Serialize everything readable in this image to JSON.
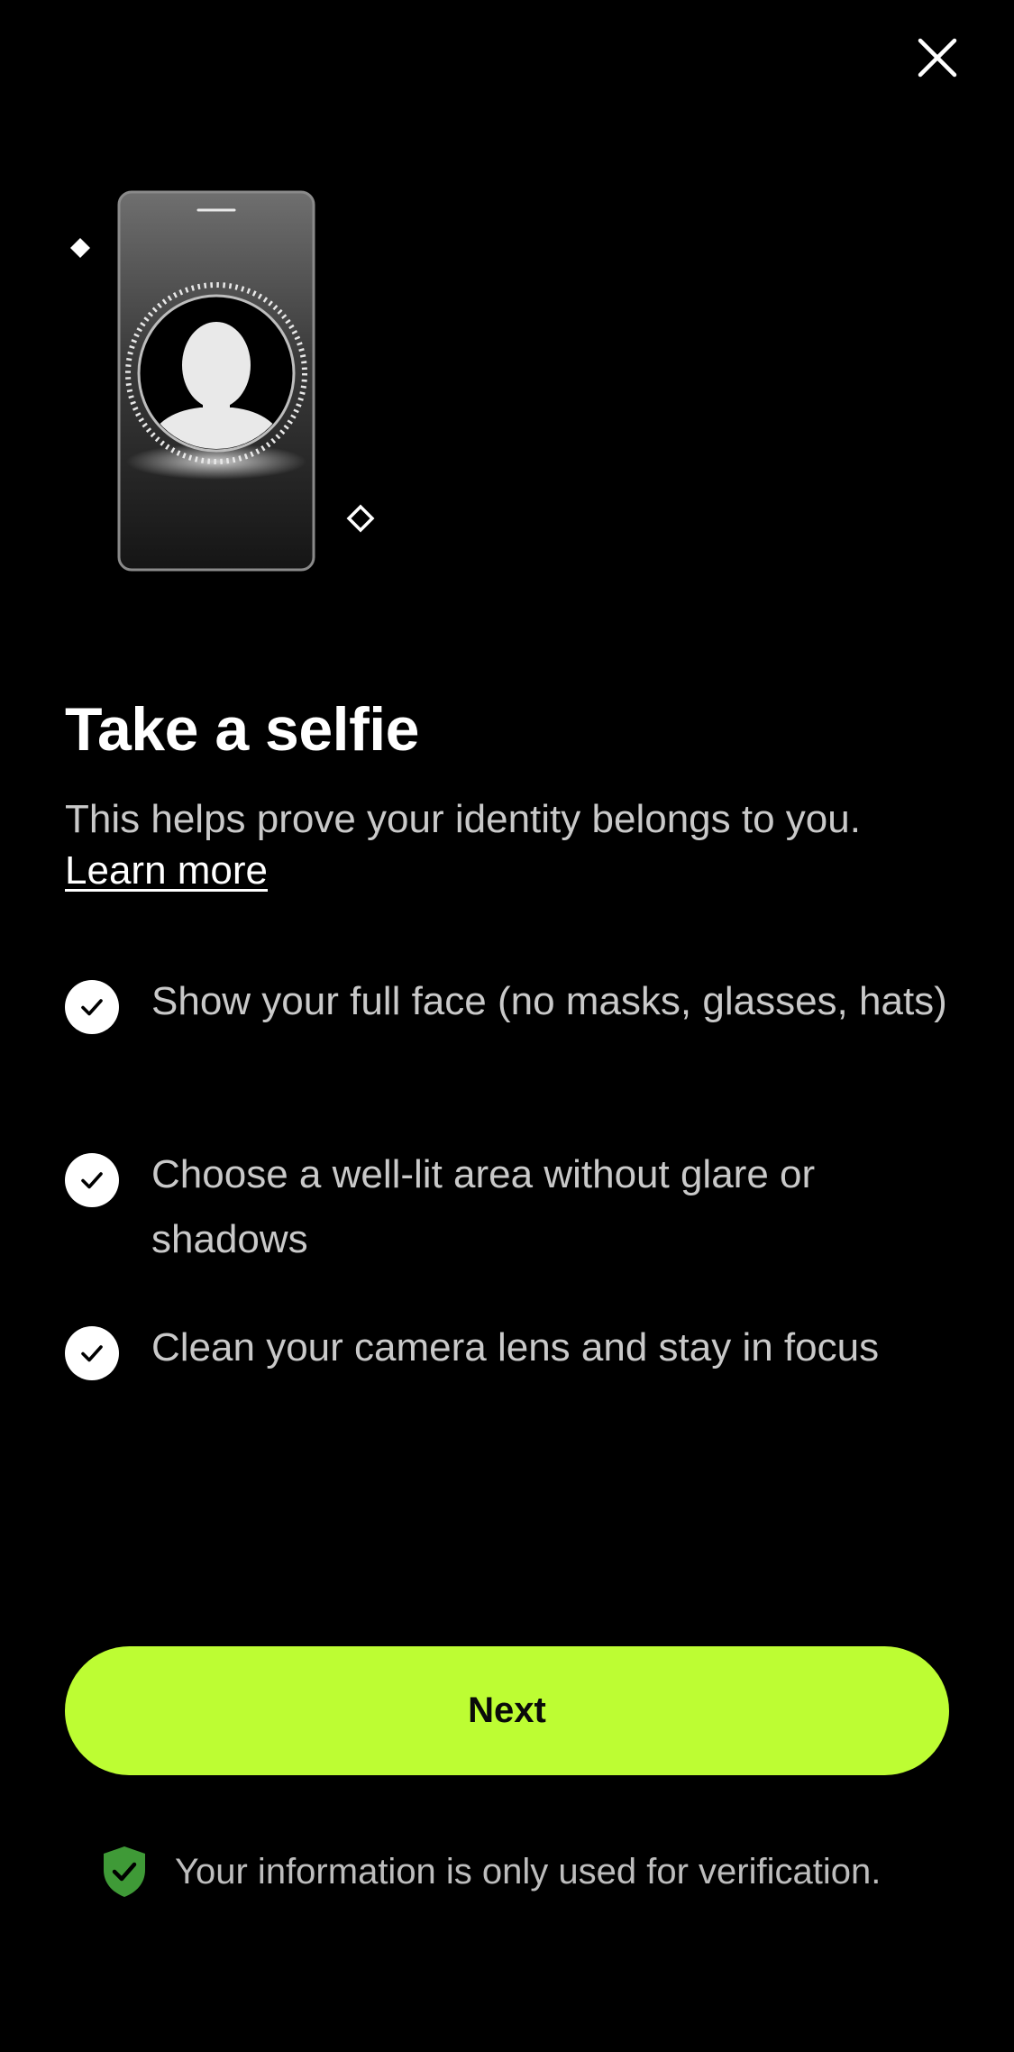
{
  "header": {
    "close_icon": "close-icon"
  },
  "illustration": {
    "phone_icon": "phone-selfie-illustration",
    "sparkle_icon": "diamond-sparkle-icon"
  },
  "main": {
    "title": "Take a selfie",
    "subtitle": "This helps prove your identity belongs to you.",
    "learn_more": "Learn more",
    "tips": [
      {
        "icon": "check-circle-icon",
        "text": "Show your full face (no masks, glasses, hats)"
      },
      {
        "icon": "check-circle-icon",
        "text": "Choose a well-lit area without glare or shadows"
      },
      {
        "icon": "check-circle-icon",
        "text": "Clean your camera lens and stay in focus"
      }
    ]
  },
  "actions": {
    "next_label": "Next"
  },
  "footer": {
    "shield_icon": "shield-check-icon",
    "note": "Your information is only used for verification."
  },
  "colors": {
    "background": "#000000",
    "accent": "#bdfd33",
    "shield": "#3f9a37",
    "text_secondary": "#c9c9c9"
  }
}
